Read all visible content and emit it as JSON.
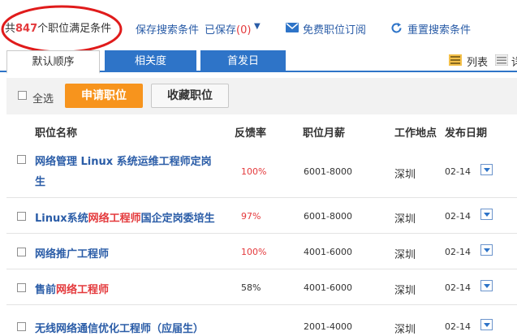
{
  "summary": {
    "prefix": "共",
    "count": "847",
    "suffix": "个职位满足条件"
  },
  "top_actions": {
    "save_search": "保存搜索条件",
    "saved_prefix": "已保存",
    "saved_count": "(0)",
    "subscribe": "免费职位订阅",
    "reset": "重置搜索条件"
  },
  "tabs": [
    {
      "label": "默认顺序",
      "active": true
    },
    {
      "label": "相关度",
      "active": false
    },
    {
      "label": "首发日",
      "active": false
    }
  ],
  "view_options": {
    "list_label": "列表",
    "detail_label": "详"
  },
  "actions": {
    "select_all": "全选",
    "apply": "申请职位",
    "save": "收藏职位"
  },
  "columns": {
    "name": "职位名称",
    "feedback": "反馈率",
    "salary": "职位月薪",
    "location": "工作地点",
    "date": "发布日期"
  },
  "jobs": [
    {
      "title_lines": [
        [
          "网络管理 Linux 系统运维工程师定岗"
        ],
        [
          "生"
        ]
      ],
      "title_highlight": [
        [
          false
        ],
        [
          false
        ]
      ],
      "feedback": "100%",
      "feedback_red": true,
      "salary": "6001-8000",
      "location": "深圳",
      "date": "02-14"
    },
    {
      "title_lines": [
        [
          "Linux系统",
          "网络工程师",
          "国企定岗委培生"
        ]
      ],
      "title_highlight": [
        [
          false,
          true,
          false
        ]
      ],
      "feedback": "97%",
      "feedback_red": true,
      "salary": "6001-8000",
      "location": "深圳",
      "date": "02-14"
    },
    {
      "title_lines": [
        [
          "网络推广工程师"
        ]
      ],
      "title_highlight": [
        [
          false
        ]
      ],
      "feedback": "100%",
      "feedback_red": true,
      "salary": "4001-6000",
      "location": "深圳",
      "date": "02-14"
    },
    {
      "title_lines": [
        [
          "售前",
          "网络工程师"
        ]
      ],
      "title_highlight": [
        [
          false,
          true
        ]
      ],
      "feedback": "58%",
      "feedback_red": false,
      "salary": "4001-6000",
      "location": "深圳",
      "date": "02-14"
    },
    {
      "title_lines": [
        [
          "无线网络通信优化工程师（应届生）"
        ]
      ],
      "title_highlight": [
        [
          false
        ]
      ],
      "feedback": "",
      "feedback_red": false,
      "salary": "2001-4000",
      "location": "深圳",
      "date": "02-14"
    }
  ],
  "colors": {
    "link_blue": "#2a5ca7",
    "tab_blue": "#2e74c8",
    "highlight_red": "#e4393c",
    "apply_orange": "#f7941d",
    "annotation_red": "#e01b1b"
  },
  "icons": {
    "mail": "envelope-icon",
    "refresh": "refresh-icon",
    "list_view": "list-view-icon",
    "detail_view": "detail-view-icon",
    "expand": "expand-down-icon"
  }
}
